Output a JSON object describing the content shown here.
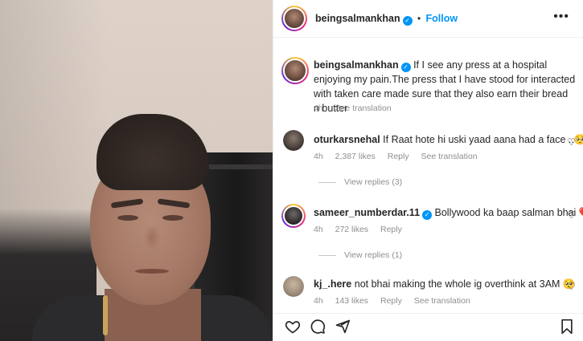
{
  "post": {
    "author": "beingsalmankhan",
    "follow_label": "Follow",
    "verified_icon": "verified-badge-icon",
    "more_icon": "more-options-icon",
    "caption": "If I see any press at a hospital enjoying my pain.The press that I have stood for interacted with taken care made sure that they also earn their bread n butter",
    "caption_time": "4h",
    "see_translation": "See translation"
  },
  "comments": [
    {
      "user": "oturkarsnehal",
      "text": "If Raat hote hi uski yaad aana had a face ..🥺🥺",
      "time": "4h",
      "likes": "2,387 likes",
      "reply": "Reply",
      "see_translation": "See translation",
      "view_replies": "View replies (3)"
    },
    {
      "user": "sameer_numberdar.11",
      "text": "Bollywood ka baap salman bhai ❤️",
      "time": "4h",
      "likes": "272 likes",
      "reply": "Reply",
      "view_replies": "View replies (1)"
    },
    {
      "user": "kj_.here",
      "text": "not bhai making the whole ig overthink at 3AM 🥺",
      "time": "4h",
      "likes": "143 likes",
      "reply": "Reply",
      "see_translation": "See translation"
    }
  ],
  "icons": {
    "heart": "♡",
    "comment": "○",
    "share": "➢",
    "save": "☐",
    "dots": "•••",
    "check": "✔"
  },
  "colors": {
    "link_blue": "#0095f6",
    "meta_gray": "#8e8e8e",
    "text": "#262626"
  }
}
